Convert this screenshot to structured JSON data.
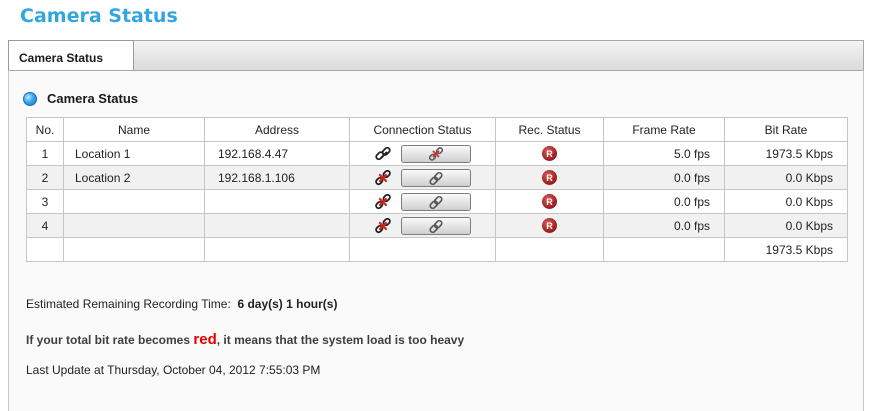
{
  "page": {
    "title": "Camera Status"
  },
  "tabs": [
    {
      "label": "Camera Status",
      "active": true
    }
  ],
  "section": {
    "title": "Camera Status",
    "icon": "blue-dot-icon"
  },
  "table": {
    "headers": [
      "No.",
      "Name",
      "Address",
      "Connection Status",
      "Rec. Status",
      "Frame Rate",
      "Bit Rate"
    ],
    "rows": [
      {
        "no": "1",
        "name": "Location 1",
        "address": "192.168.4.47",
        "connected": true,
        "rec": "R",
        "frame_rate": "5.0 fps",
        "bit_rate": "1973.5 Kbps"
      },
      {
        "no": "2",
        "name": "Location 2",
        "address": "192.168.1.106",
        "connected": false,
        "rec": "R",
        "frame_rate": "0.0 fps",
        "bit_rate": "0.0 Kbps"
      },
      {
        "no": "3",
        "name": "",
        "address": "",
        "connected": false,
        "rec": "R",
        "frame_rate": "0.0 fps",
        "bit_rate": "0.0 Kbps"
      },
      {
        "no": "4",
        "name": "",
        "address": "",
        "connected": false,
        "rec": "R",
        "frame_rate": "0.0 fps",
        "bit_rate": "0.0 Kbps"
      }
    ],
    "total_bit_rate": "1973.5 Kbps"
  },
  "info": {
    "remaining_label": "Estimated Remaining Recording Time:",
    "remaining_value": "6 day(s) 1 hour(s)",
    "warning_prefix": "If your total bit rate becomes",
    "warning_red": "red",
    "warning_suffix": ", it means that the system load is too heavy",
    "last_update": "Last Update at Thursday, October 04, 2012 7:55:03 PM"
  },
  "colors": {
    "title": "#33a6e0",
    "rec": "#a31f1f",
    "disconnect_x": "#d62020",
    "warning_red": "#e60000"
  }
}
